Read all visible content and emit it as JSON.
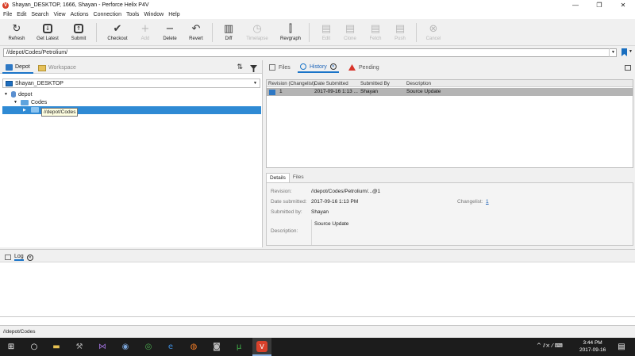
{
  "window": {
    "title": "Shayan_DESKTOP,  1666,  Shayan - Perforce Helix P4V",
    "logo_letter": "V",
    "controls": [
      "—",
      "❐",
      "✕"
    ]
  },
  "menu": [
    "File",
    "Edit",
    "Search",
    "View",
    "Actions",
    "Connection",
    "Tools",
    "Window",
    "Help"
  ],
  "toolbar": {
    "refresh": "Refresh",
    "get_latest": "Get Latest",
    "submit": "Submit",
    "checkout": "Checkout",
    "add": "Add",
    "delete": "Delete",
    "revert": "Revert",
    "diff": "Diff",
    "timelapse": "Timelapse",
    "revgraph": "Revgraph",
    "edit": "Edit",
    "clone": "Clone",
    "fetch": "Fetch",
    "push": "Push",
    "cancel": "Cancel"
  },
  "path_bar": {
    "value": "//depot/Codes/Petrolium/"
  },
  "left": {
    "tabs": {
      "depot": "Depot",
      "workspace": "Workspace"
    },
    "workspace_select": "Shayan_DESKTOP",
    "tree": {
      "depot": "depot",
      "codes": "Codes"
    },
    "tooltip": "//depot/Codes"
  },
  "right": {
    "tabs": {
      "files": "Files",
      "history": "History",
      "pending": "Pending"
    },
    "columns": [
      "Revision (Changelist)",
      "Date Submitted",
      "Submitted By",
      "Description"
    ],
    "rows": [
      {
        "revision": "1",
        "date": "2017-09-16 1:13 ...",
        "by": "Shayan",
        "description": "Source Update"
      }
    ],
    "details_tabs": {
      "details": "Details",
      "files": "Files"
    },
    "details": {
      "revision_label": "Revision:",
      "revision_value": "//depot/Codes/Petrolium/...@1",
      "date_label": "Date submitted:",
      "date_value": "2017-09-16 1:13 PM",
      "changelist_label": "Changelist:",
      "changelist_value": "1",
      "submitted_label": "Submitted by:",
      "submitted_value": "Shayan",
      "description_label": "Description:",
      "description_value": "Source Update"
    }
  },
  "log": {
    "tab": "Log"
  },
  "status": {
    "path": "//depot/Codes"
  },
  "taskbar": {
    "time": "3:44 PM",
    "date": "2017-09-16",
    "tray": "^ ⫽× ⁄ ⌨"
  },
  "colors": {
    "accent": "#1a74c8",
    "selection": "#2f8ad4",
    "history_row": "#b4b4b4"
  }
}
